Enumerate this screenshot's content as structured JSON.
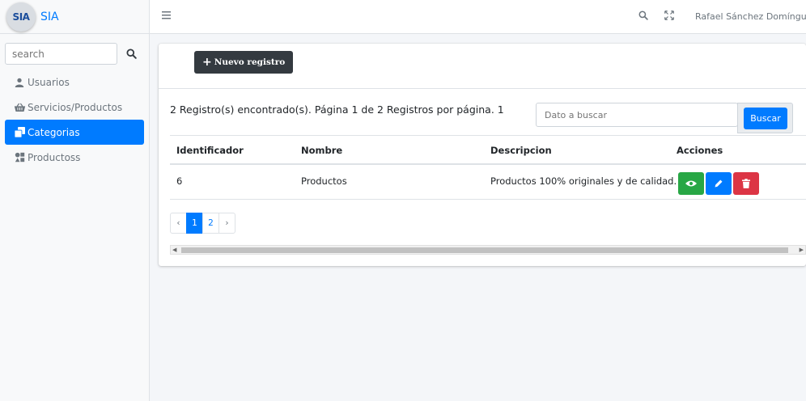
{
  "brand": {
    "logo_text": "SIA",
    "name": "SIA"
  },
  "sidebar": {
    "search_placeholder": "search",
    "items": [
      {
        "label": "Usuarios",
        "icon": "user-icon",
        "active": false
      },
      {
        "label": "Servicios/Productos",
        "icon": "basket-icon",
        "active": false
      },
      {
        "label": "Categorias",
        "icon": "clone-icon",
        "active": true
      },
      {
        "label": "Productoss",
        "icon": "shapes-icon",
        "active": false
      }
    ]
  },
  "topbar": {
    "user_name": "Rafael Sánchez Domínguez"
  },
  "main": {
    "new_button_label": "Nuevo registro",
    "records_text": "2 Registro(s) encontrado(s). Página 1 de 2 Registros por página. 1",
    "search_placeholder": "Dato a buscar",
    "search_button_label": "Buscar",
    "table": {
      "headers": [
        "Identificador",
        "Nombre",
        "Descripcion",
        "Acciones"
      ],
      "rows": [
        {
          "id": "6",
          "name": "Productos",
          "description": "Productos 100% originales y de calidad."
        }
      ]
    },
    "pagination": {
      "prev": "‹",
      "pages": [
        "1",
        "2"
      ],
      "next": "›",
      "current": "1"
    }
  },
  "colors": {
    "primary": "#007bff",
    "dark": "#343a40",
    "success": "#28a745",
    "danger": "#dc3545"
  }
}
